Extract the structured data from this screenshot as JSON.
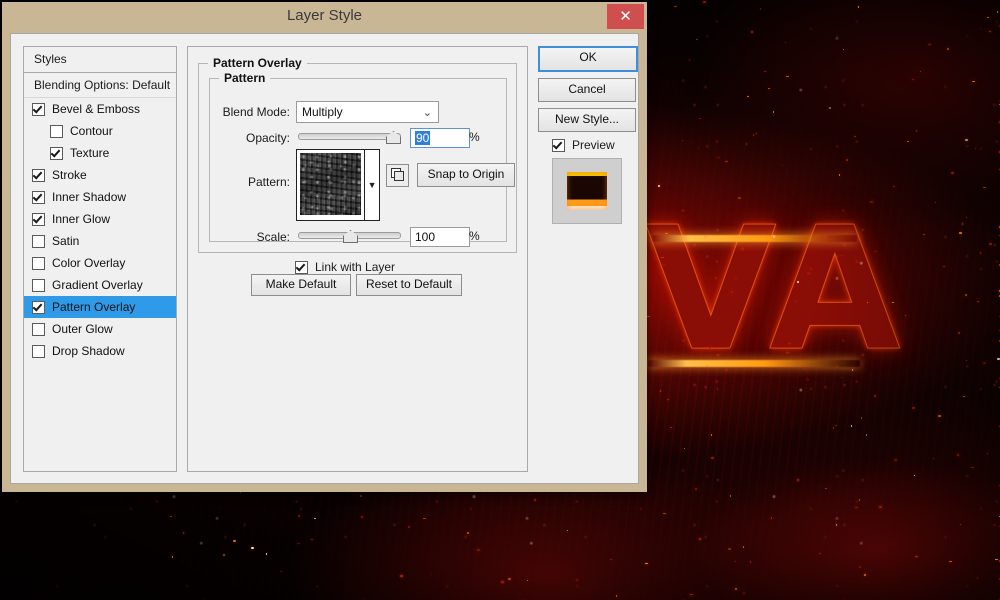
{
  "window": {
    "title": "Layer Style",
    "close_label": "✕",
    "close_icon": "close-icon"
  },
  "styles_panel": {
    "header": "Styles",
    "blending_options": "Blending Options: Default",
    "items": [
      {
        "label": "Bevel & Emboss",
        "checked": true,
        "indent": false,
        "selected": false
      },
      {
        "label": "Contour",
        "checked": false,
        "indent": true,
        "selected": false
      },
      {
        "label": "Texture",
        "checked": true,
        "indent": true,
        "selected": false
      },
      {
        "label": "Stroke",
        "checked": true,
        "indent": false,
        "selected": false
      },
      {
        "label": "Inner Shadow",
        "checked": true,
        "indent": false,
        "selected": false
      },
      {
        "label": "Inner Glow",
        "checked": true,
        "indent": false,
        "selected": false
      },
      {
        "label": "Satin",
        "checked": false,
        "indent": false,
        "selected": false
      },
      {
        "label": "Color Overlay",
        "checked": false,
        "indent": false,
        "selected": false
      },
      {
        "label": "Gradient Overlay",
        "checked": false,
        "indent": false,
        "selected": false
      },
      {
        "label": "Pattern Overlay",
        "checked": true,
        "indent": false,
        "selected": true
      },
      {
        "label": "Outer Glow",
        "checked": false,
        "indent": false,
        "selected": false
      },
      {
        "label": "Drop Shadow",
        "checked": false,
        "indent": false,
        "selected": false
      }
    ]
  },
  "main": {
    "group_title": "Pattern Overlay",
    "subgroup_title": "Pattern",
    "blend_mode": {
      "label": "Blend Mode:",
      "value": "Multiply",
      "chevron": "⌄"
    },
    "opacity": {
      "label": "Opacity:",
      "value": "90",
      "unit": "%",
      "slider_percent": 90
    },
    "pattern": {
      "label": "Pattern:",
      "dropdown_arrow": "▼",
      "new_pattern_icon": "new-pattern-icon",
      "snap_button": "Snap to Origin"
    },
    "scale": {
      "label": "Scale:",
      "value": "100",
      "unit": "%",
      "slider_percent": 50
    },
    "link_with_layer": {
      "label": "Link with Layer",
      "checked": true
    },
    "make_default": "Make Default",
    "reset_to_default": "Reset to Default"
  },
  "right": {
    "ok": "OK",
    "cancel": "Cancel",
    "new_style": "New Style...",
    "preview": {
      "label": "Preview",
      "checked": true
    }
  },
  "colors": {
    "titlebar": "#c9b694",
    "close_button": "#cf4f4f",
    "selection": "#2f9ae8",
    "focus_border": "#3f8ddd",
    "panel": "#f0f0f0"
  },
  "background": {
    "description": "lava-text-artwork",
    "letters": "VA"
  }
}
